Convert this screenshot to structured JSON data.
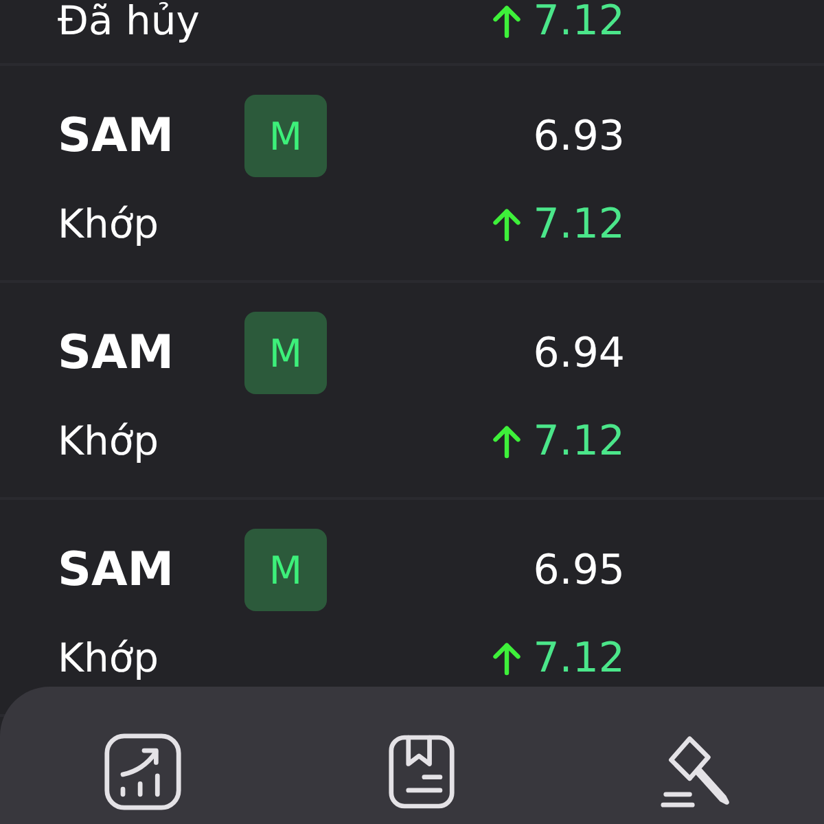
{
  "partial_order": {
    "status": "Đã hủy",
    "match_price": "7.12",
    "kind": "up"
  },
  "orders": [
    {
      "symbol": "SAM",
      "badge": "M",
      "price": "6.93",
      "status": "Khớp",
      "match_price": "7.12",
      "kind": "up"
    },
    {
      "symbol": "SAM",
      "badge": "M",
      "price": "6.94",
      "status": "Khớp",
      "match_price": "7.12",
      "kind": "up"
    },
    {
      "symbol": "SAM",
      "badge": "M",
      "price": "6.95",
      "status": "Khớp",
      "match_price": "7.12",
      "kind": "up"
    }
  ],
  "bottom_nav": [
    {
      "kind": "chart"
    },
    {
      "kind": "book"
    },
    {
      "kind": "gavel"
    }
  ]
}
